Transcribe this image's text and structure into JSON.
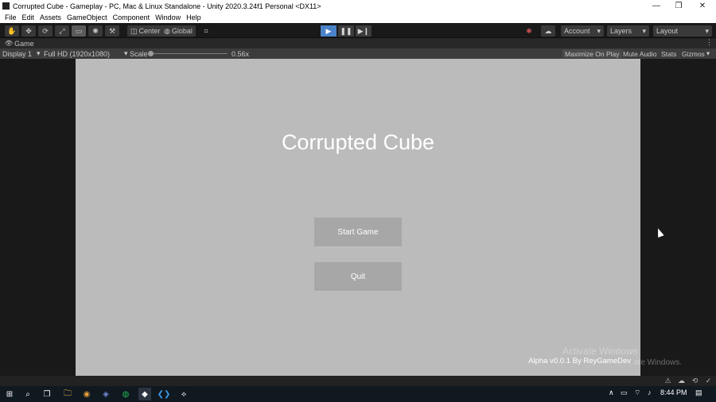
{
  "window": {
    "title": "Corrupted Cube - Gameplay - PC, Mac & Linux Standalone - Unity 2020.3.24f1 Personal <DX11>",
    "minimize_glyph": "—",
    "restore_glyph": "❐",
    "close_glyph": "✕"
  },
  "menu": [
    "File",
    "Edit",
    "Assets",
    "GameObject",
    "Component",
    "Window",
    "Help"
  ],
  "toolbar": {
    "tools": [
      {
        "name": "hand-tool-icon",
        "glyph": "✋"
      },
      {
        "name": "move-tool-icon",
        "glyph": "✥"
      },
      {
        "name": "rotate-tool-icon",
        "glyph": "⟳"
      },
      {
        "name": "scale-tool-icon",
        "glyph": "⤢"
      },
      {
        "name": "rect-tool-icon",
        "glyph": "▭"
      },
      {
        "name": "transform-tool-icon",
        "glyph": "✺"
      },
      {
        "name": "custom-tool-icon",
        "glyph": "⚒"
      }
    ],
    "pivot_label": "Center",
    "pivot_glyph": "◫",
    "space_label": "Global",
    "space_glyph": "◍",
    "snap_glyph": "⌗",
    "play_glyph": "▶",
    "pause_glyph": "❚❚",
    "step_glyph": "▶❙",
    "collab_glyph": "✱",
    "cloud_glyph": "☁",
    "account_label": "Account",
    "layers_label": "Layers",
    "layout_label": "Layout",
    "dropdown_glyph": "▾"
  },
  "tab": {
    "label": "Game",
    "eye_glyph": "👁",
    "menu_glyph": "⋮"
  },
  "gamebar": {
    "display": "Display 1",
    "resolution": "Full HD (1920x1080)",
    "scale_label": "Scale",
    "scale_value": "0.56x",
    "maximize": "Maximize On Play",
    "mute": "Mute Audio",
    "stats": "Stats",
    "gizmos": "Gizmos"
  },
  "game": {
    "title": "Corrupted Cube",
    "start_label": "Start Game",
    "quit_label": "Quit",
    "version": "Alpha v0.0.1 By ReyGameDev"
  },
  "watermark": {
    "line1": "Activate Windows",
    "line2": "ate Windows."
  },
  "status_icons": [
    "⚠",
    "☁",
    "⟲",
    "✓"
  ],
  "taskbar": {
    "start_glyph": "⊞",
    "search_glyph": "⌕",
    "taskview_glyph": "❐",
    "apps": [
      {
        "name": "file-explorer-icon",
        "glyph": "🗀"
      },
      {
        "name": "chrome-icon",
        "glyph": "◉"
      },
      {
        "name": "discord-icon",
        "glyph": "◈"
      },
      {
        "name": "spotify-icon",
        "glyph": "◍"
      },
      {
        "name": "unity-hub-icon",
        "glyph": "◆"
      },
      {
        "name": "vscode-icon",
        "glyph": "❮❯"
      },
      {
        "name": "unity-icon",
        "glyph": "⟡"
      }
    ],
    "tray_chevron": "∧",
    "tray_icons": [
      "▭",
      "⌔",
      "♪"
    ],
    "time": "8:44 PM",
    "notify_glyph": "▤"
  },
  "colors": {
    "game_bg": "#bbbbbb",
    "button_bg": "#a7a7a7",
    "editor_bg": "#191919",
    "play_active": "#4a82c8"
  }
}
